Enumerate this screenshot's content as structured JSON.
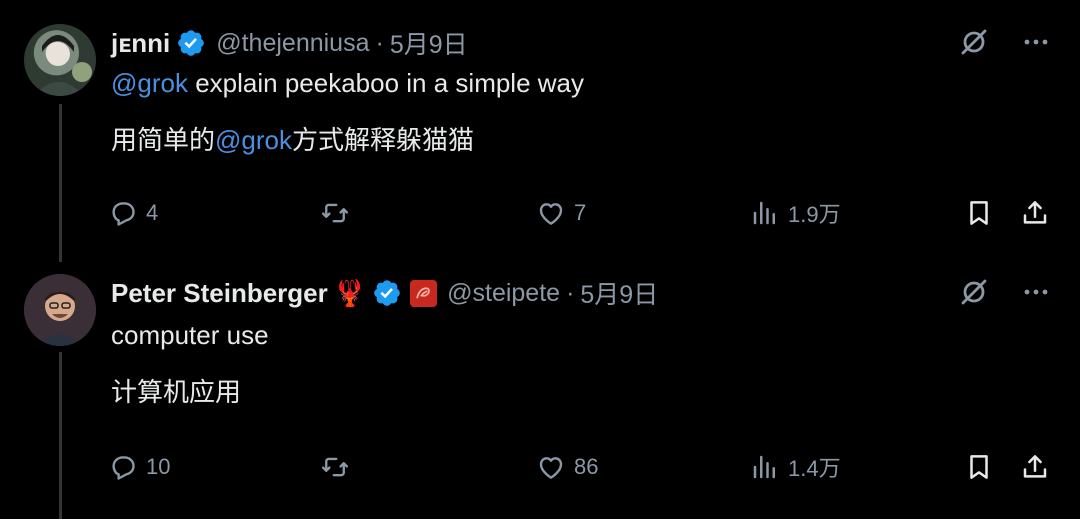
{
  "tweets": [
    {
      "name": "jᴇnni",
      "handle": "@thejenniusa",
      "separator": "·",
      "date": "5月9日",
      "line1_mention": "@grok",
      "line1_rest": " explain peekaboo in a simple way",
      "line2_pre": "用简单的",
      "line2_mention": "@grok",
      "line2_post": "方式解释躲猫猫",
      "replies": "4",
      "likes": "7",
      "views": "1.9万"
    },
    {
      "name": "Peter Steinberger",
      "emoji": "🦞",
      "handle": "@steipete",
      "separator": "·",
      "date": "5月9日",
      "line1": "computer use",
      "line2": "计算机应用",
      "replies": "10",
      "likes": "86",
      "views": "1.4万"
    }
  ],
  "colors": {
    "background": "#000000",
    "text": "#e7e9ea",
    "secondary": "#8b98a5",
    "mention": "#4b8fe0",
    "verified": "#1d9bf0",
    "badge": "#c8291f"
  },
  "icons": [
    "verified-icon",
    "grok-icon",
    "more-icon",
    "reply-icon",
    "retweet-icon",
    "like-icon",
    "views-icon",
    "bookmark-icon",
    "share-icon",
    "lobster-icon",
    "affiliate-badge-icon"
  ]
}
